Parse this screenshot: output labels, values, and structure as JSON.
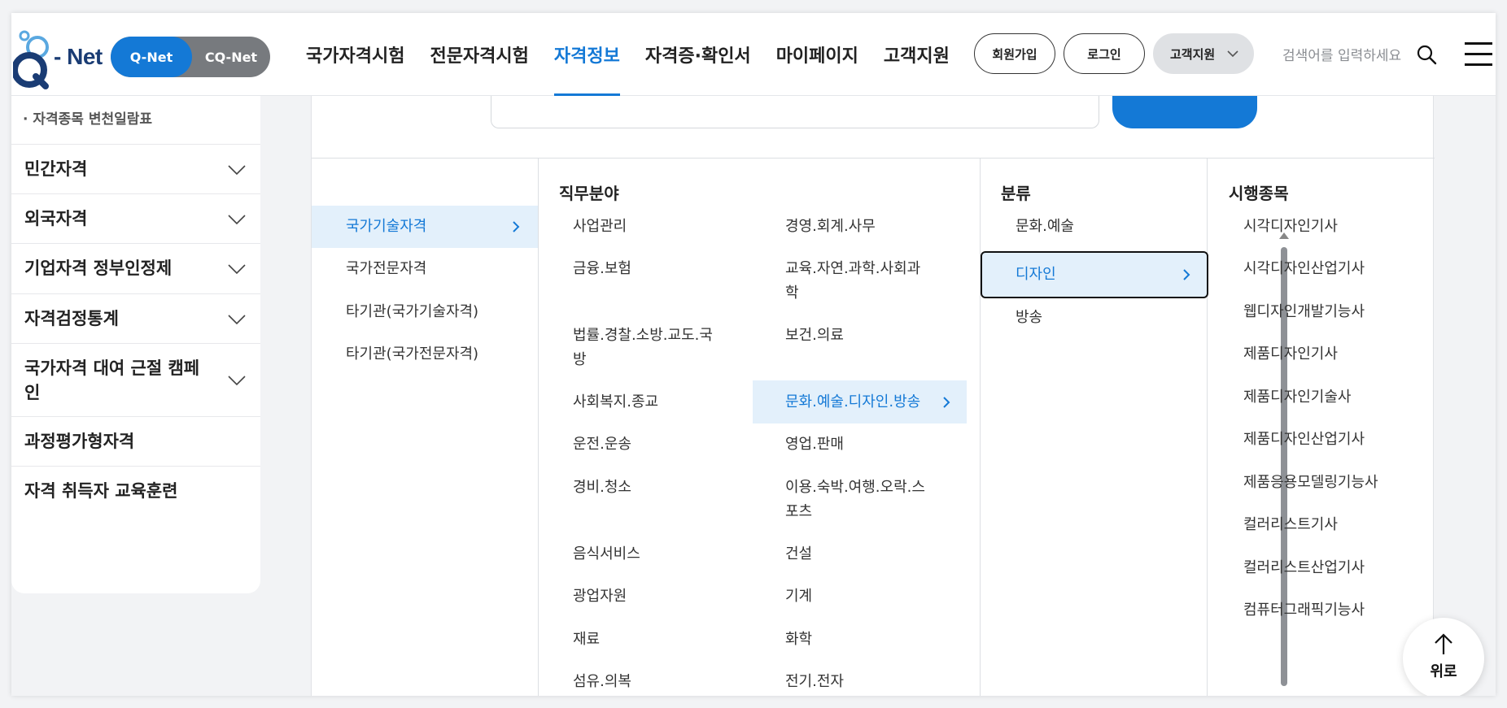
{
  "header": {
    "logo_text": "- Net",
    "site_toggle": {
      "active": "Q-Net",
      "inactive": "CQ-Net"
    },
    "nav": [
      "국가자격시험",
      "전문자격시험",
      "자격정보",
      "자격증·확인서",
      "마이페이지",
      "고객지원"
    ],
    "active_nav": "자격정보",
    "signup": "회원가입",
    "login": "로그인",
    "support_dropdown": "고객지원",
    "search_placeholder": "검색어를 입력하세요"
  },
  "sidebar": {
    "sub_item": "자격종목 변천일람표",
    "items": [
      {
        "label": "민간자격",
        "expandable": true
      },
      {
        "label": "외국자격",
        "expandable": true
      },
      {
        "label": "기업자격 정부인정제",
        "expandable": true
      },
      {
        "label": "자격검정통계",
        "expandable": true
      },
      {
        "label": "국가자격 대여 근절 캠페인",
        "label_line1": "국가자격 대여 근절 캠페",
        "label_line2": "인",
        "expandable": true
      },
      {
        "label": "과정평가형자격",
        "expandable": false
      },
      {
        "label": "자격 취득자 교육훈련",
        "expandable": false
      }
    ]
  },
  "finder": {
    "categories": [
      "국가기술자격",
      "국가전문자격",
      "타기관(국가기술자격)",
      "타기관(국가전문자격)"
    ],
    "selected_category": "국가기술자격",
    "job_field_head": "직무분야",
    "job_fields_left": [
      "사업관리",
      "금융.보험",
      "법률.경찰.소방.교도.국방",
      "사회복지.종교",
      "운전.운송",
      "경비.청소",
      "음식서비스",
      "광업자원",
      "재료",
      "섬유.의복"
    ],
    "job_fields_left_wrapped": {
      "법률.경찰.소방.교도.국방": [
        "법률.경찰.소방.교도.국",
        "방"
      ]
    },
    "job_fields_right": [
      "경영.회계.사무",
      "교육.자연.과학.사회과학",
      "보건.의료",
      "문화.예술.디자인.방송",
      "영업.판매",
      "이용.숙박.여행.오락.스포츠",
      "건설",
      "기계",
      "화학",
      "전기.전자"
    ],
    "job_fields_right_wrapped": {
      "교육.자연.과학.사회과학": [
        "교육.자연.과학.사회과",
        "학"
      ],
      "이용.숙박.여행.오락.스포츠": [
        "이용.숙박.여행.오락.스",
        "포츠"
      ]
    },
    "selected_job_field": "문화.예술.디자인.방송",
    "class_head": "분류",
    "classes": [
      "문화.예술",
      "디자인",
      "방송"
    ],
    "selected_class": "디자인",
    "exam_head": "시행종목",
    "exams": [
      "시각디자인기사",
      "시각디자인산업기사",
      "웹디자인개발기능사",
      "제품디자인기사",
      "제품디자인기술사",
      "제품디자인산업기사",
      "제품응용모델링기능사",
      "컬러리스트기사",
      "컬러리스트산업기사",
      "컴퓨터그래픽기능사"
    ]
  },
  "top_button": "위로",
  "colors": {
    "accent": "#1479d6",
    "selected_bg": "#e3f0fb",
    "toggle_inactive": "#777a7e"
  }
}
